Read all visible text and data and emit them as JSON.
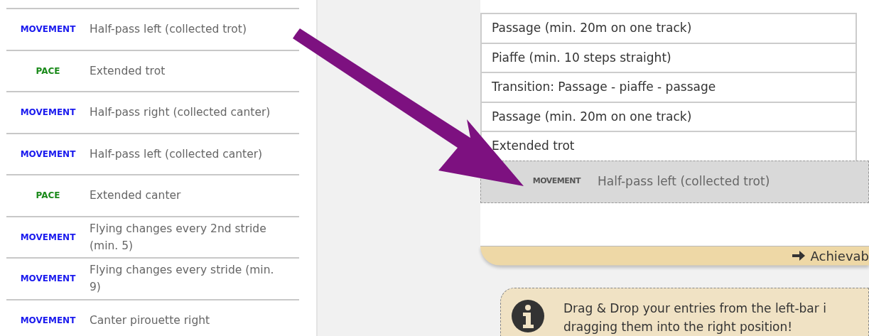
{
  "sidebar": {
    "items": [
      {
        "tag": "MOVEMENT",
        "kind": "movement",
        "label": "Half-pass left (collected trot)"
      },
      {
        "tag": "PACE",
        "kind": "pace",
        "label": "Extended trot"
      },
      {
        "tag": "MOVEMENT",
        "kind": "movement",
        "label": "Half-pass right (collected canter)"
      },
      {
        "tag": "MOVEMENT",
        "kind": "movement",
        "label": "Half-pass left (collected canter)"
      },
      {
        "tag": "PACE",
        "kind": "pace",
        "label": "Extended canter"
      },
      {
        "tag": "MOVEMENT",
        "kind": "movement",
        "label": "Flying changes every 2nd stride (min. 5)"
      },
      {
        "tag": "MOVEMENT",
        "kind": "movement",
        "label": "Flying changes every stride (min. 9)"
      },
      {
        "tag": "MOVEMENT",
        "kind": "movement",
        "label": "Canter pirouette right"
      }
    ]
  },
  "sequence": {
    "rows": [
      {
        "label": "Passage (min. 20m on one track)"
      },
      {
        "label": "Piaffe (min. 10 steps straight)"
      },
      {
        "label": "Transition: Passage - piaffe - passage"
      },
      {
        "label": "Passage (min. 20m on one track)"
      },
      {
        "label": "Extended trot"
      }
    ],
    "dragged": {
      "tag": "MOVEMENT",
      "label": "Half-pass left (collected trot)"
    },
    "footer": "Achievab"
  },
  "info": {
    "lines": [
      "Drag & Drop your entries from the left-bar i",
      "dragging them into the right position!"
    ]
  }
}
